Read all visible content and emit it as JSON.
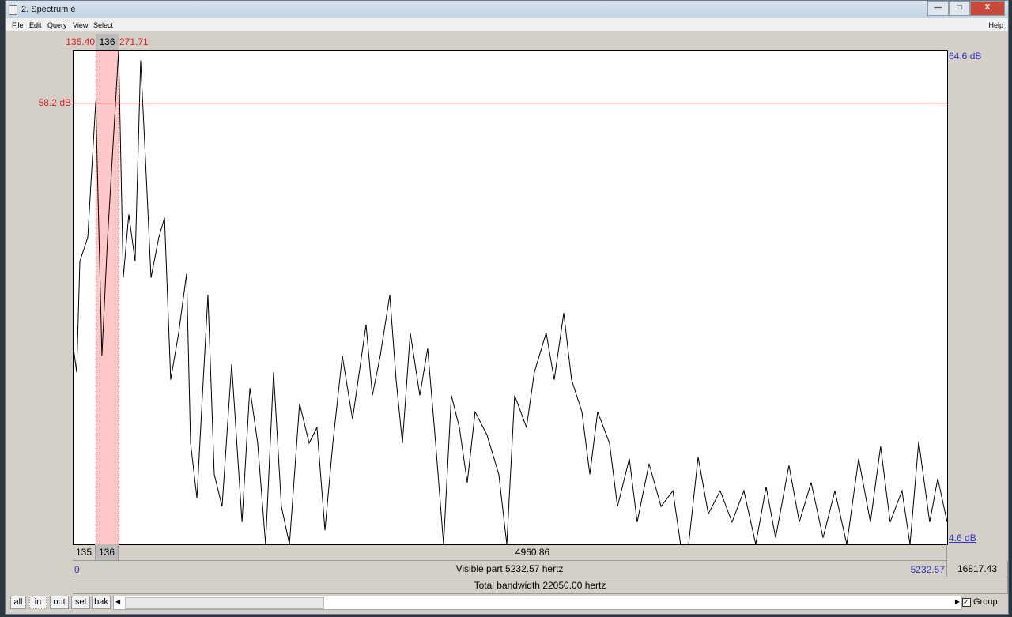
{
  "window": {
    "title": "2. Spectrum é",
    "minimize": "—",
    "maximize": "□",
    "close": "X"
  },
  "menu": {
    "items": [
      "File",
      "Edit",
      "Query",
      "View",
      "Select"
    ],
    "help": "Help"
  },
  "selection": {
    "start_label": "135.40",
    "width_label": "136",
    "end_label": "271.71",
    "cursor_db_label": "58.2 dB",
    "cursor_db": 58.2,
    "start_hz": 135.4,
    "end_hz": 271.71
  },
  "axis": {
    "top_label": "64.6 dB",
    "bottom_label": "4.6 dB",
    "left_label": "0",
    "right_label": "5232.57"
  },
  "rows": {
    "row1": [
      "135",
      "136",
      "4960.86"
    ],
    "visible_part": "Visible part 5232.57 hertz",
    "right_remaining": "16817.43",
    "total": "Total bandwidth 22050.00 hertz"
  },
  "buttons": [
    "all",
    "in",
    "out",
    "sel",
    "bak"
  ],
  "group": {
    "label": "Group",
    "checked": true
  },
  "colors": {
    "selection": "#ffc8c8",
    "cursor": "#d42020",
    "axis_blue": "#3030c8"
  },
  "chart_data": {
    "type": "line",
    "xlim": [
      0,
      5232.57
    ],
    "ylim": [
      4.6,
      64.6
    ],
    "series": [
      {
        "x": [
          0,
          19,
          38,
          85,
          133,
          170,
          204,
          270,
          298,
          331,
          369,
          402,
          431,
          464,
          511,
          545,
          582,
          630,
          677,
          701,
          739,
          772,
          805,
          843,
          890,
          947,
          1009,
          1056,
          1103,
          1150,
          1198,
          1245,
          1293,
          1354,
          1411,
          1458,
          1506,
          1553,
          1610,
          1671,
          1752,
          1790,
          1837,
          1894,
          1932,
          1970,
          2017,
          2074,
          2121,
          2169,
          2216,
          2263,
          2311,
          2358,
          2405,
          2476,
          2547,
          2595,
          2642,
          2713,
          2760,
          2831,
          2879,
          2936,
          2983,
          3045,
          3092,
          3139,
          3210,
          3258,
          3329,
          3376,
          3447,
          3519,
          3590,
          3636,
          3684,
          3741,
          3802,
          3873,
          3944,
          4015,
          4086,
          4148,
          4205,
          4285,
          4347,
          4418,
          4489,
          4560,
          4631,
          4702,
          4773,
          4834,
          4891,
          4962,
          5010,
          5062,
          5128,
          5176,
          5232.57
        ],
        "y": [
          28.4,
          25.5,
          39,
          41.9,
          58.4,
          27.5,
          41.9,
          64.6,
          37,
          44.7,
          39,
          63.4,
          51.4,
          37,
          41.9,
          44.3,
          24.6,
          30.3,
          37.5,
          16.9,
          10.2,
          22.7,
          34.9,
          13.1,
          9.2,
          26.5,
          7.3,
          23.6,
          16.9,
          4.6,
          25.5,
          9.2,
          4.6,
          21.7,
          16.9,
          18.8,
          6.3,
          16.9,
          27.5,
          19.8,
          31.3,
          22.7,
          27.5,
          34.9,
          24.6,
          16.9,
          30.3,
          22.7,
          28.4,
          16.9,
          4.6,
          22.7,
          18.8,
          12.1,
          20.7,
          17.9,
          13.1,
          4.6,
          22.7,
          18.8,
          25.5,
          30.3,
          24.6,
          32.7,
          24.6,
          20.7,
          13.1,
          20.7,
          16.9,
          9.2,
          15,
          7.3,
          14.4,
          9.2,
          11.1,
          4.6,
          4.6,
          15.2,
          8.3,
          11.1,
          7.3,
          11.1,
          4.6,
          11.6,
          5.4,
          14.2,
          7.3,
          12.1,
          5.4,
          11.1,
          4.6,
          15,
          7.3,
          16.5,
          7.3,
          11.1,
          4.6,
          17.1,
          7.3,
          12.6,
          7.3
        ]
      }
    ]
  }
}
